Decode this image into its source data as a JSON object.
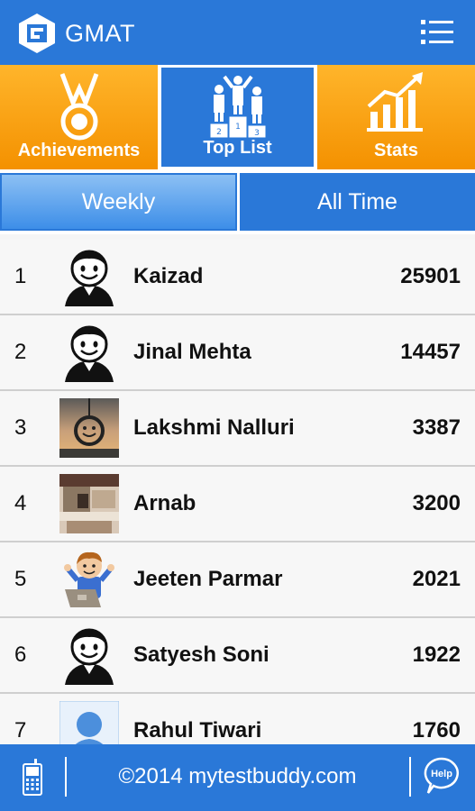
{
  "app": {
    "title": "GMAT",
    "logo_letter": "G"
  },
  "categories": [
    {
      "label": "Achievements",
      "icon": "medal-icon"
    },
    {
      "label": "Top List",
      "icon": "podium-icon"
    },
    {
      "label": "Stats",
      "icon": "bar-chart-icon"
    }
  ],
  "tabs": [
    {
      "label": "Weekly",
      "active": true
    },
    {
      "label": "All Time",
      "active": false
    }
  ],
  "leaderboard": [
    {
      "rank": "1",
      "name": "Kaizad",
      "score": "25901",
      "avatar": "default-avatar"
    },
    {
      "rank": "2",
      "name": "Jinal Mehta",
      "score": "14457",
      "avatar": "default-avatar"
    },
    {
      "rank": "3",
      "name": "Lakshmi Nalluri",
      "score": "3387",
      "avatar": "photo-smiley-pendant"
    },
    {
      "rank": "4",
      "name": "Arnab",
      "score": "3200",
      "avatar": "photo-room"
    },
    {
      "rank": "5",
      "name": "Jeeten Parmar",
      "score": "2021",
      "avatar": "cartoon-laptop-avatar"
    },
    {
      "rank": "6",
      "name": "Satyesh Soni",
      "score": "1922",
      "avatar": "default-avatar"
    },
    {
      "rank": "7",
      "name": "Rahul Tiwari",
      "score": "1760",
      "avatar": "silhouette-avatar"
    }
  ],
  "footer": {
    "copyright": "©2014 mytestbuddy.com",
    "help_label": "Help"
  },
  "colors": {
    "primary": "#2a78d8",
    "orange": "#f49100",
    "active_tab": "#5ca2ee"
  }
}
